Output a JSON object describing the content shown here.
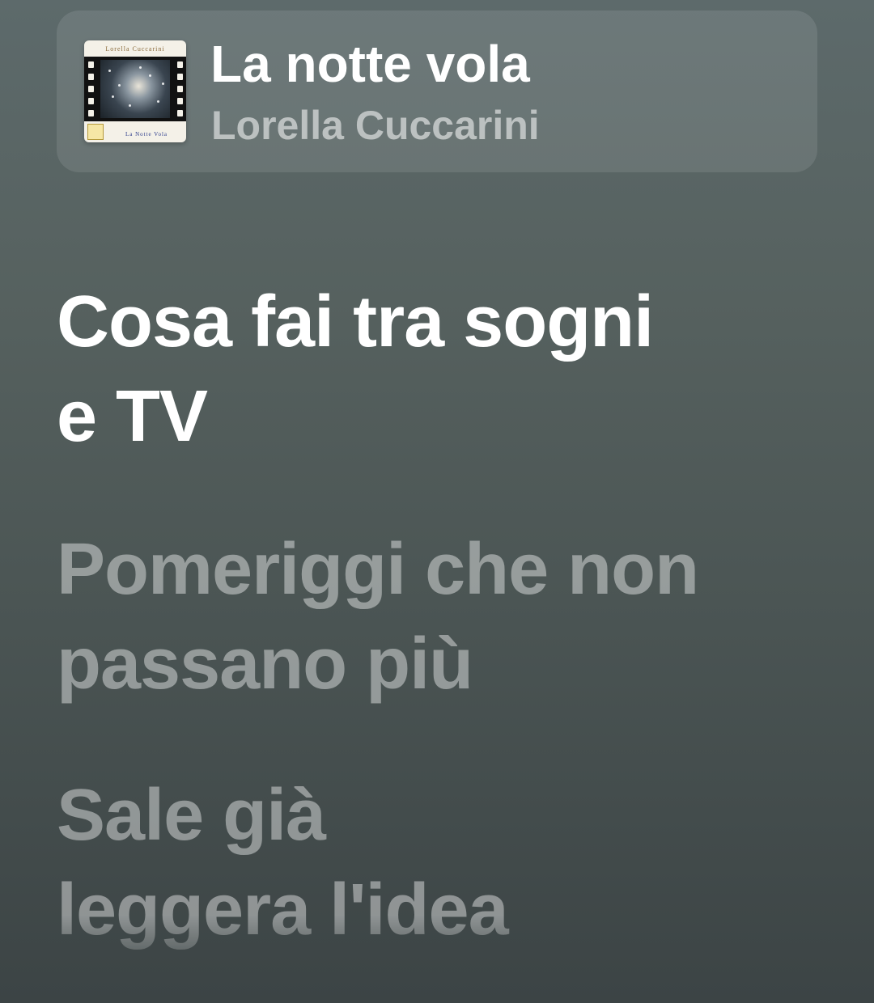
{
  "now_playing": {
    "title": "La notte vola",
    "artist": "Lorella Cuccarini",
    "album_art": {
      "top_text": "Lorella Cuccarini",
      "bottom_text": "La Notte Vola"
    }
  },
  "lyrics": {
    "lines": [
      "Cosa fai tra sogni",
      "e TV",
      "Pomeriggi che non",
      "passano più",
      "Sale già",
      "leggera l'idea"
    ]
  },
  "colors": {
    "background_top": "#5d6a6b",
    "background_bottom": "#3c4445",
    "active_lyric": "#ffffff",
    "inactive_lyric": "#a3aaa9"
  }
}
